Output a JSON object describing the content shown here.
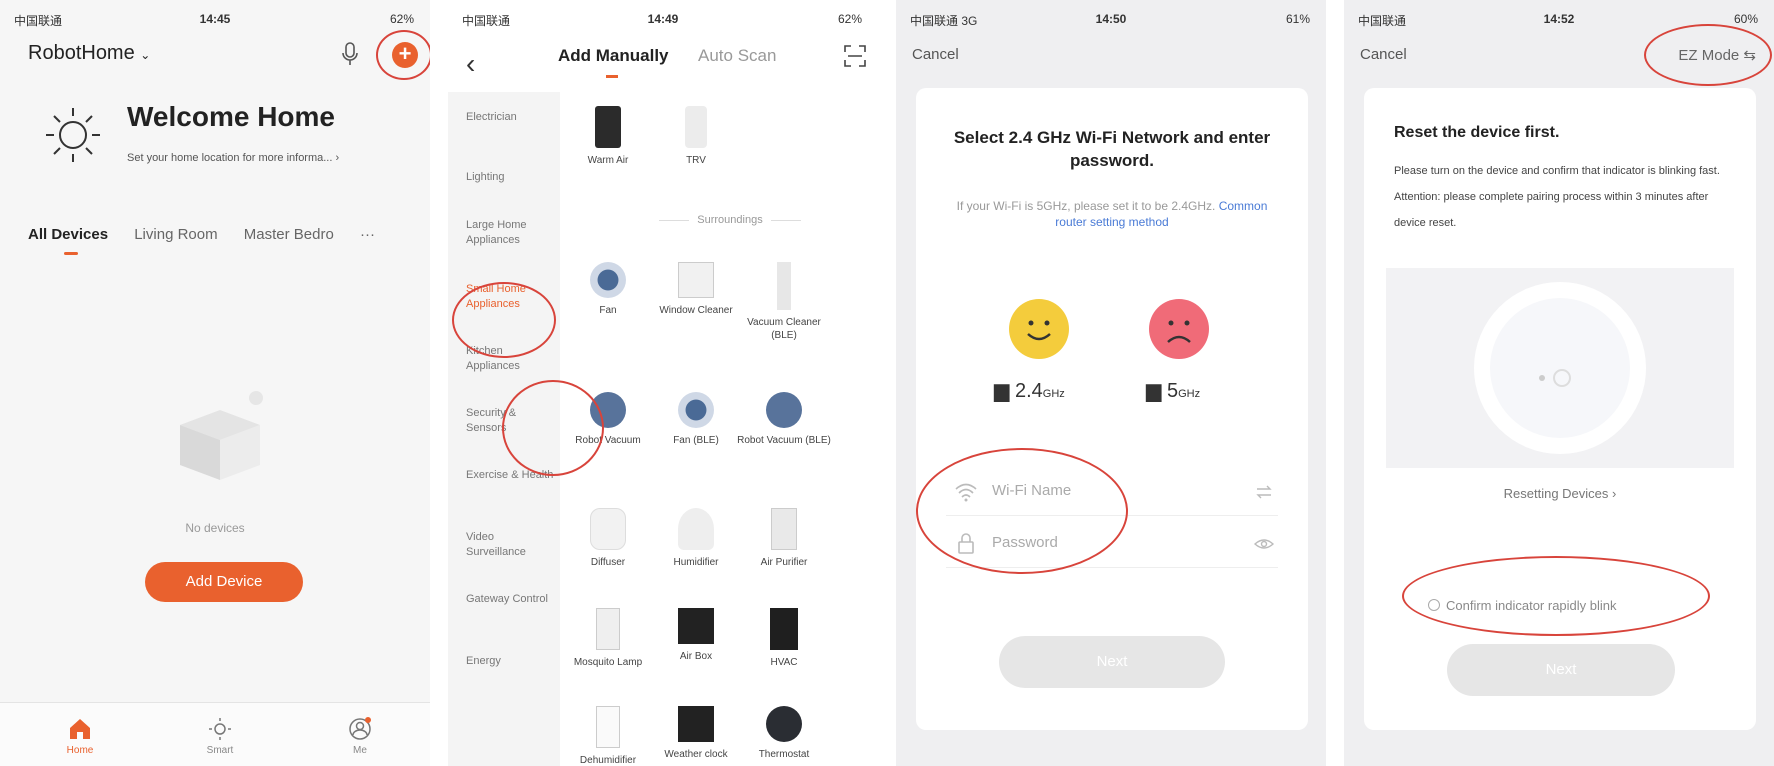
{
  "status_bars": [
    {
      "carrier": "中国联通",
      "time": "14:45",
      "right": "62%"
    },
    {
      "carrier": "中国联通",
      "time": "14:49",
      "right": "62%"
    },
    {
      "carrier": "中国联通 3G",
      "time": "14:50",
      "right": "61%"
    },
    {
      "carrier": "中国联通",
      "time": "14:52",
      "right": "60%"
    }
  ],
  "home": {
    "title": "RobotHome",
    "welcome": "Welcome Home",
    "welcome_sub": "Set your home location for more informa...",
    "tabs": [
      "All Devices",
      "Living Room",
      "Master Bedro",
      "···"
    ],
    "no_devices": "No devices",
    "add_device": "Add Device",
    "tabbar": [
      "Home",
      "Smart",
      "Me"
    ]
  },
  "add": {
    "tab_manual": "Add Manually",
    "tab_auto": "Auto Scan",
    "categories": [
      "Electrician",
      "Lighting",
      "Large Home Appliances",
      "Small Home Appliances",
      "Kitchen Appliances",
      "Security & Sensors",
      "Exercise & Health",
      "Video Surveillance",
      "Gateway Control",
      "Energy"
    ],
    "top_devices": [
      "Warm Air",
      "TRV"
    ],
    "section": "Surroundings",
    "devices": [
      "Fan",
      "Window Cleaner",
      "Vacuum Cleaner (BLE)",
      "Robot Vacuum",
      "Fan (BLE)",
      "Robot Vacuum (BLE)",
      "Diffuser",
      "Humidifier",
      "Air Purifier",
      "Mosquito Lamp",
      "Air Box",
      "HVAC",
      "Dehumidifier",
      "Weather clock",
      "Thermostat"
    ]
  },
  "wifi": {
    "cancel": "Cancel",
    "title": "Select 2.4 GHz Wi-Fi Network and enter password.",
    "hint": "If your Wi-Fi is 5GHz, please set it to be 2.4GHz.",
    "hint_link": "Common router setting method",
    "band_good": "2.4",
    "band_bad": "5",
    "unit": "GHz",
    "ssid_placeholder": "Wi-Fi Name",
    "password_placeholder": "Password",
    "next": "Next"
  },
  "reset": {
    "cancel": "Cancel",
    "mode": "EZ Mode",
    "title": "Reset the device first.",
    "body": "Please turn on the device and confirm that indicator is blinking fast. Attention: please complete pairing process within 3 minutes after device reset.",
    "resetting": "Resetting Devices ›",
    "confirm": "Confirm indicator rapidly blink",
    "next": "Next"
  },
  "colors": {
    "accent": "#e9612e",
    "annotation": "#d8443b",
    "link": "#4a7bd6",
    "good": "#f4cc3c",
    "bad": "#f06b78"
  }
}
